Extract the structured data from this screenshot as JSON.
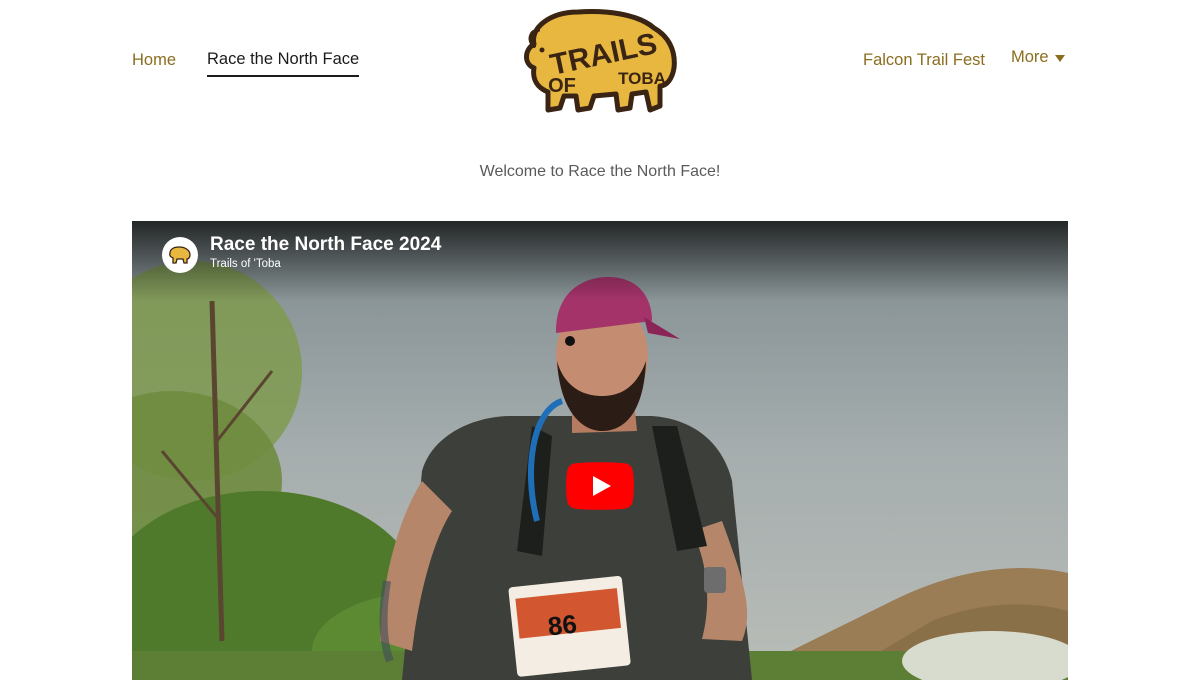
{
  "nav": {
    "home": "Home",
    "race": "Race the North Face",
    "falcon": "Falcon Trail Fest",
    "more": "More"
  },
  "logo": {
    "text_top": "TRAILS",
    "text_left": "OF",
    "text_right": "TOBA",
    "icon": "bison-logo-icon",
    "color_fill": "#e8b73f",
    "color_outline": "#3a2413"
  },
  "main": {
    "welcome": "Welcome to Race the North Face!"
  },
  "video": {
    "title": "Race the North Face 2024",
    "channel": "Trails of 'Toba",
    "bib_number": "86",
    "play_icon": "youtube-play-icon",
    "avatar_icon": "bison-avatar-icon"
  },
  "colors": {
    "accent": "#8a6d1f",
    "active_nav": "#1b1b1b",
    "welcome_text": "#5a5a5a",
    "youtube_red": "#ff0000"
  }
}
